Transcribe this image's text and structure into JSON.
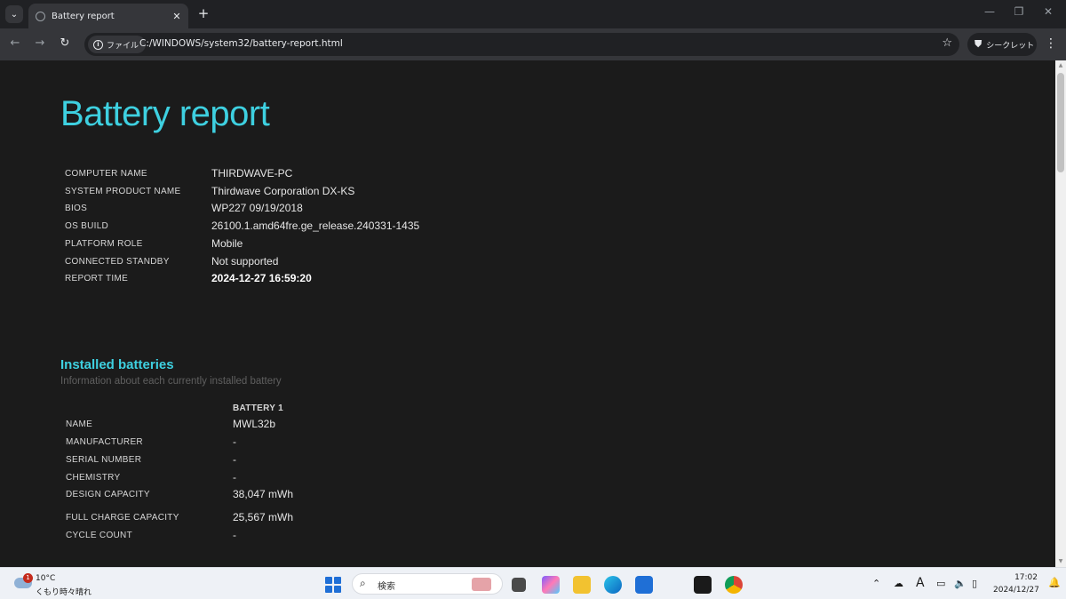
{
  "browser": {
    "tab_title": "Battery report",
    "url_scheme_label": "ファイル",
    "url": "C:/WINDOWS/system32/battery-report.html",
    "incognito_label": "シークレット"
  },
  "report": {
    "title": "Battery report",
    "system_info": [
      {
        "key": "COMPUTER NAME",
        "value": "THIRDWAVE-PC"
      },
      {
        "key": "SYSTEM PRODUCT NAME",
        "value": "Thirdwave Corporation DX-KS"
      },
      {
        "key": "BIOS",
        "value": "WP227 09/19/2018"
      },
      {
        "key": "OS BUILD",
        "value": "26100.1.amd64fre.ge_release.240331-1435"
      },
      {
        "key": "PLATFORM ROLE",
        "value": "Mobile"
      },
      {
        "key": "CONNECTED STANDBY",
        "value": "Not supported"
      },
      {
        "key": "REPORT TIME",
        "value": "2024-12-27  16:59:20"
      }
    ],
    "installed_batteries": {
      "heading": "Installed batteries",
      "subtitle": "Information about each currently installed battery",
      "column_header": "BATTERY 1",
      "rows": [
        {
          "key": "NAME",
          "value": "MWL32b"
        },
        {
          "key": "MANUFACTURER",
          "value": "-"
        },
        {
          "key": "SERIAL NUMBER",
          "value": "-"
        },
        {
          "key": "CHEMISTRY",
          "value": "-"
        },
        {
          "key": "DESIGN CAPACITY",
          "value": "38,047 mWh"
        },
        {
          "key": "FULL CHARGE CAPACITY",
          "value": "25,567 mWh"
        },
        {
          "key": "CYCLE COUNT",
          "value": "-"
        }
      ]
    }
  },
  "taskbar": {
    "weather_badge": "1",
    "weather_temp": "10°C",
    "weather_condition": "くもり時々晴れ",
    "search_placeholder": "検索",
    "clock_time": "17:02",
    "clock_date": "2024/12/27",
    "ime_indicator": "A"
  },
  "colors": {
    "accent": "#3ed0e0",
    "page_background": "#1b1b1b"
  }
}
